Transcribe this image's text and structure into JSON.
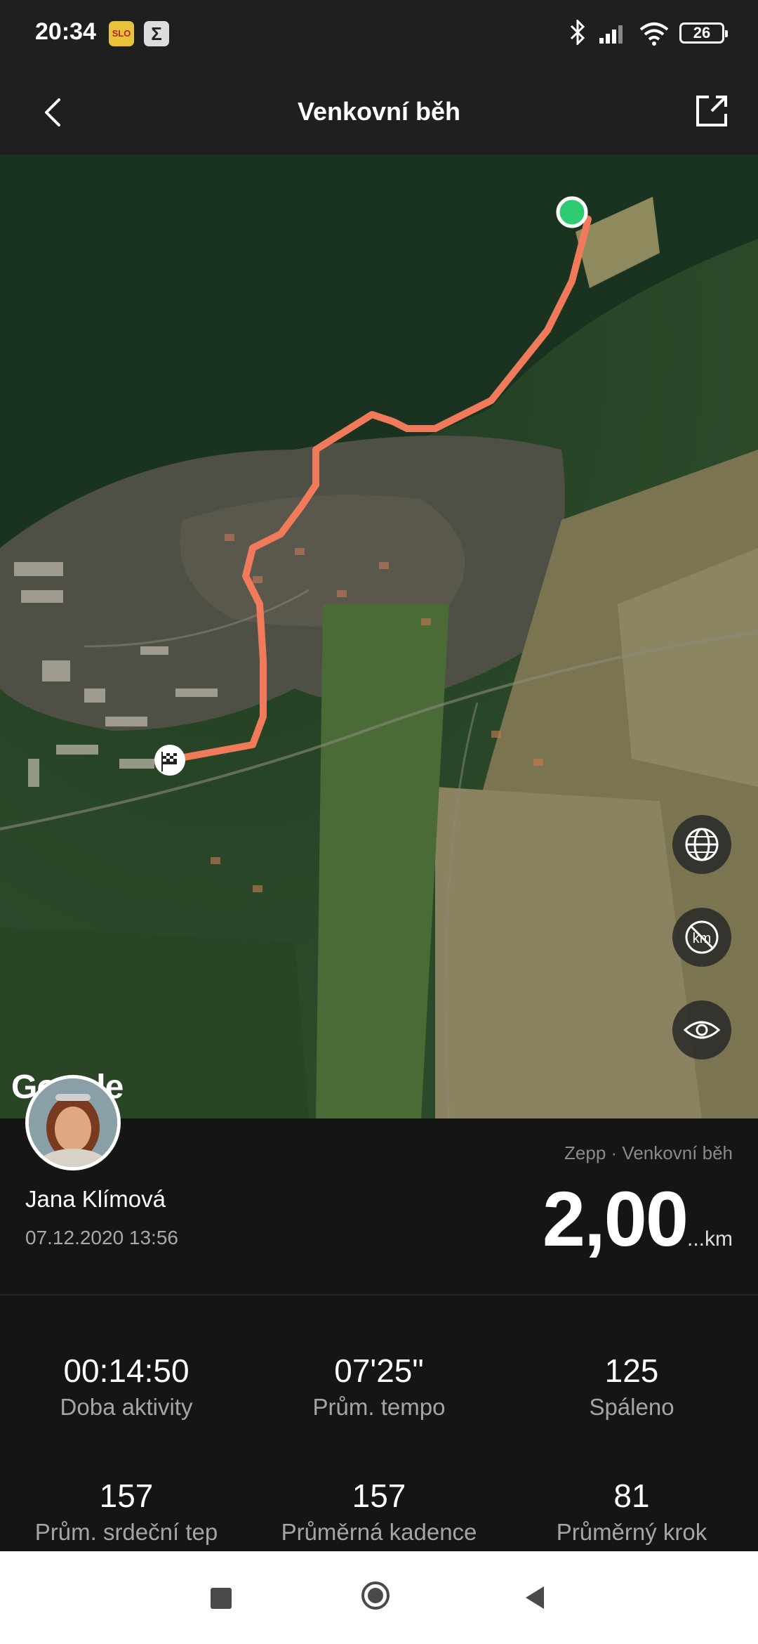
{
  "status_bar": {
    "time": "20:34",
    "battery": "26",
    "icons": [
      "bluetooth-icon",
      "signal-icon",
      "wifi-icon",
      "battery-icon"
    ]
  },
  "header": {
    "title": "Venkovní běh",
    "back_icon": "chevron-left-icon",
    "share_icon": "share-external-icon"
  },
  "map": {
    "provider": "Google",
    "controls": [
      "globe-icon",
      "km-off-icon",
      "eye-icon"
    ],
    "route_color": "#f07a5a",
    "start_color": "#2ecc71"
  },
  "workout": {
    "user_name": "Jana Klímová",
    "datetime": "07.12.2020 13:56",
    "source": "Zepp · Venkovní běh",
    "distance": "2,00",
    "distance_unit": "...km"
  },
  "stats": [
    {
      "value": "00:14:50",
      "label": "Doba aktivity"
    },
    {
      "value": "07'25\"",
      "label": "Prům. tempo"
    },
    {
      "value": "125",
      "label": "Spáleno"
    },
    {
      "value": "157",
      "label": "Prům. srdeční tep"
    },
    {
      "value": "157",
      "label": "Průměrná kadence"
    },
    {
      "value": "81",
      "label": "Průměrný krok"
    }
  ]
}
